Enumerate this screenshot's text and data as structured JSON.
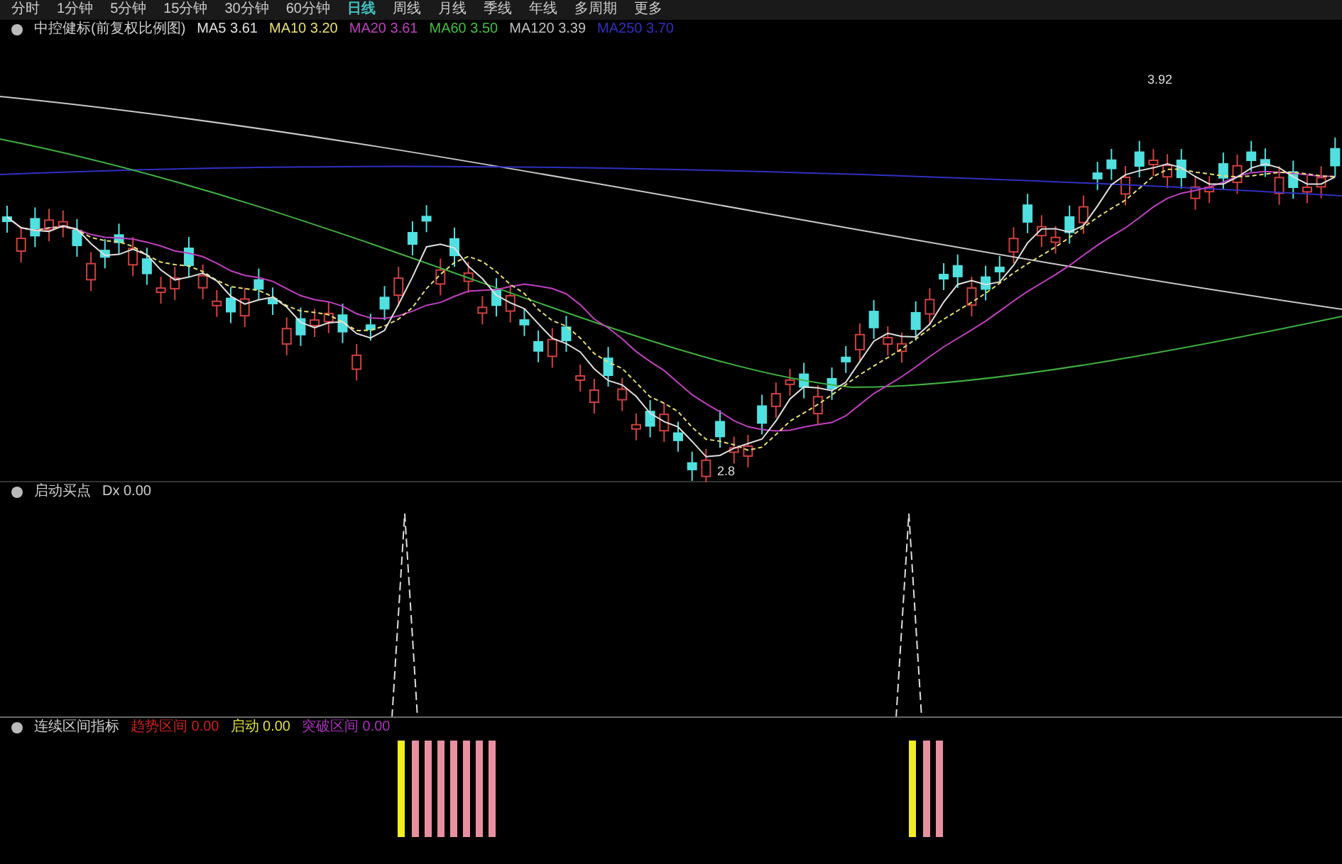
{
  "toolbar": {
    "tabs": [
      {
        "label": "分时",
        "selected": false
      },
      {
        "label": "1分钟",
        "selected": false
      },
      {
        "label": "5分钟",
        "selected": false
      },
      {
        "label": "15分钟",
        "selected": false
      },
      {
        "label": "30分钟",
        "selected": false
      },
      {
        "label": "60分钟",
        "selected": false
      },
      {
        "label": "日线",
        "selected": true
      },
      {
        "label": "周线",
        "selected": false
      },
      {
        "label": "月线",
        "selected": false
      },
      {
        "label": "季线",
        "selected": false
      },
      {
        "label": "年线",
        "selected": false
      },
      {
        "label": "多周期",
        "selected": false
      },
      {
        "label": "更多",
        "selected": false
      }
    ]
  },
  "main_panel": {
    "title": "中控健标(前复权比例图)",
    "indicators": [
      {
        "label": "MA5 3.61",
        "color": "#e0e0e0"
      },
      {
        "label": "MA10 3.20",
        "color": "#e8e070"
      },
      {
        "label": "MA20 3.61",
        "color": "#c040c0"
      },
      {
        "label": "MA60 3.50",
        "color": "#40c040"
      },
      {
        "label": "MA120 3.39",
        "color": "#c0c0c0"
      },
      {
        "label": "MA250 3.70",
        "color": "#3030c0"
      }
    ],
    "high_label": "3.92",
    "low_label": "2.8"
  },
  "signal_panel": {
    "title": "启动买点",
    "indicators": [
      {
        "label": "Dx 0.00",
        "color": "#d0d0d0"
      }
    ]
  },
  "range_panel": {
    "title": "连续区间指标",
    "indicators": [
      {
        "label": "趋势区间 0.00",
        "color": "#d02020"
      },
      {
        "label": "启动 0.00",
        "color": "#e0e040"
      },
      {
        "label": "突破区间 0.00",
        "color": "#b030c0"
      }
    ]
  }
}
